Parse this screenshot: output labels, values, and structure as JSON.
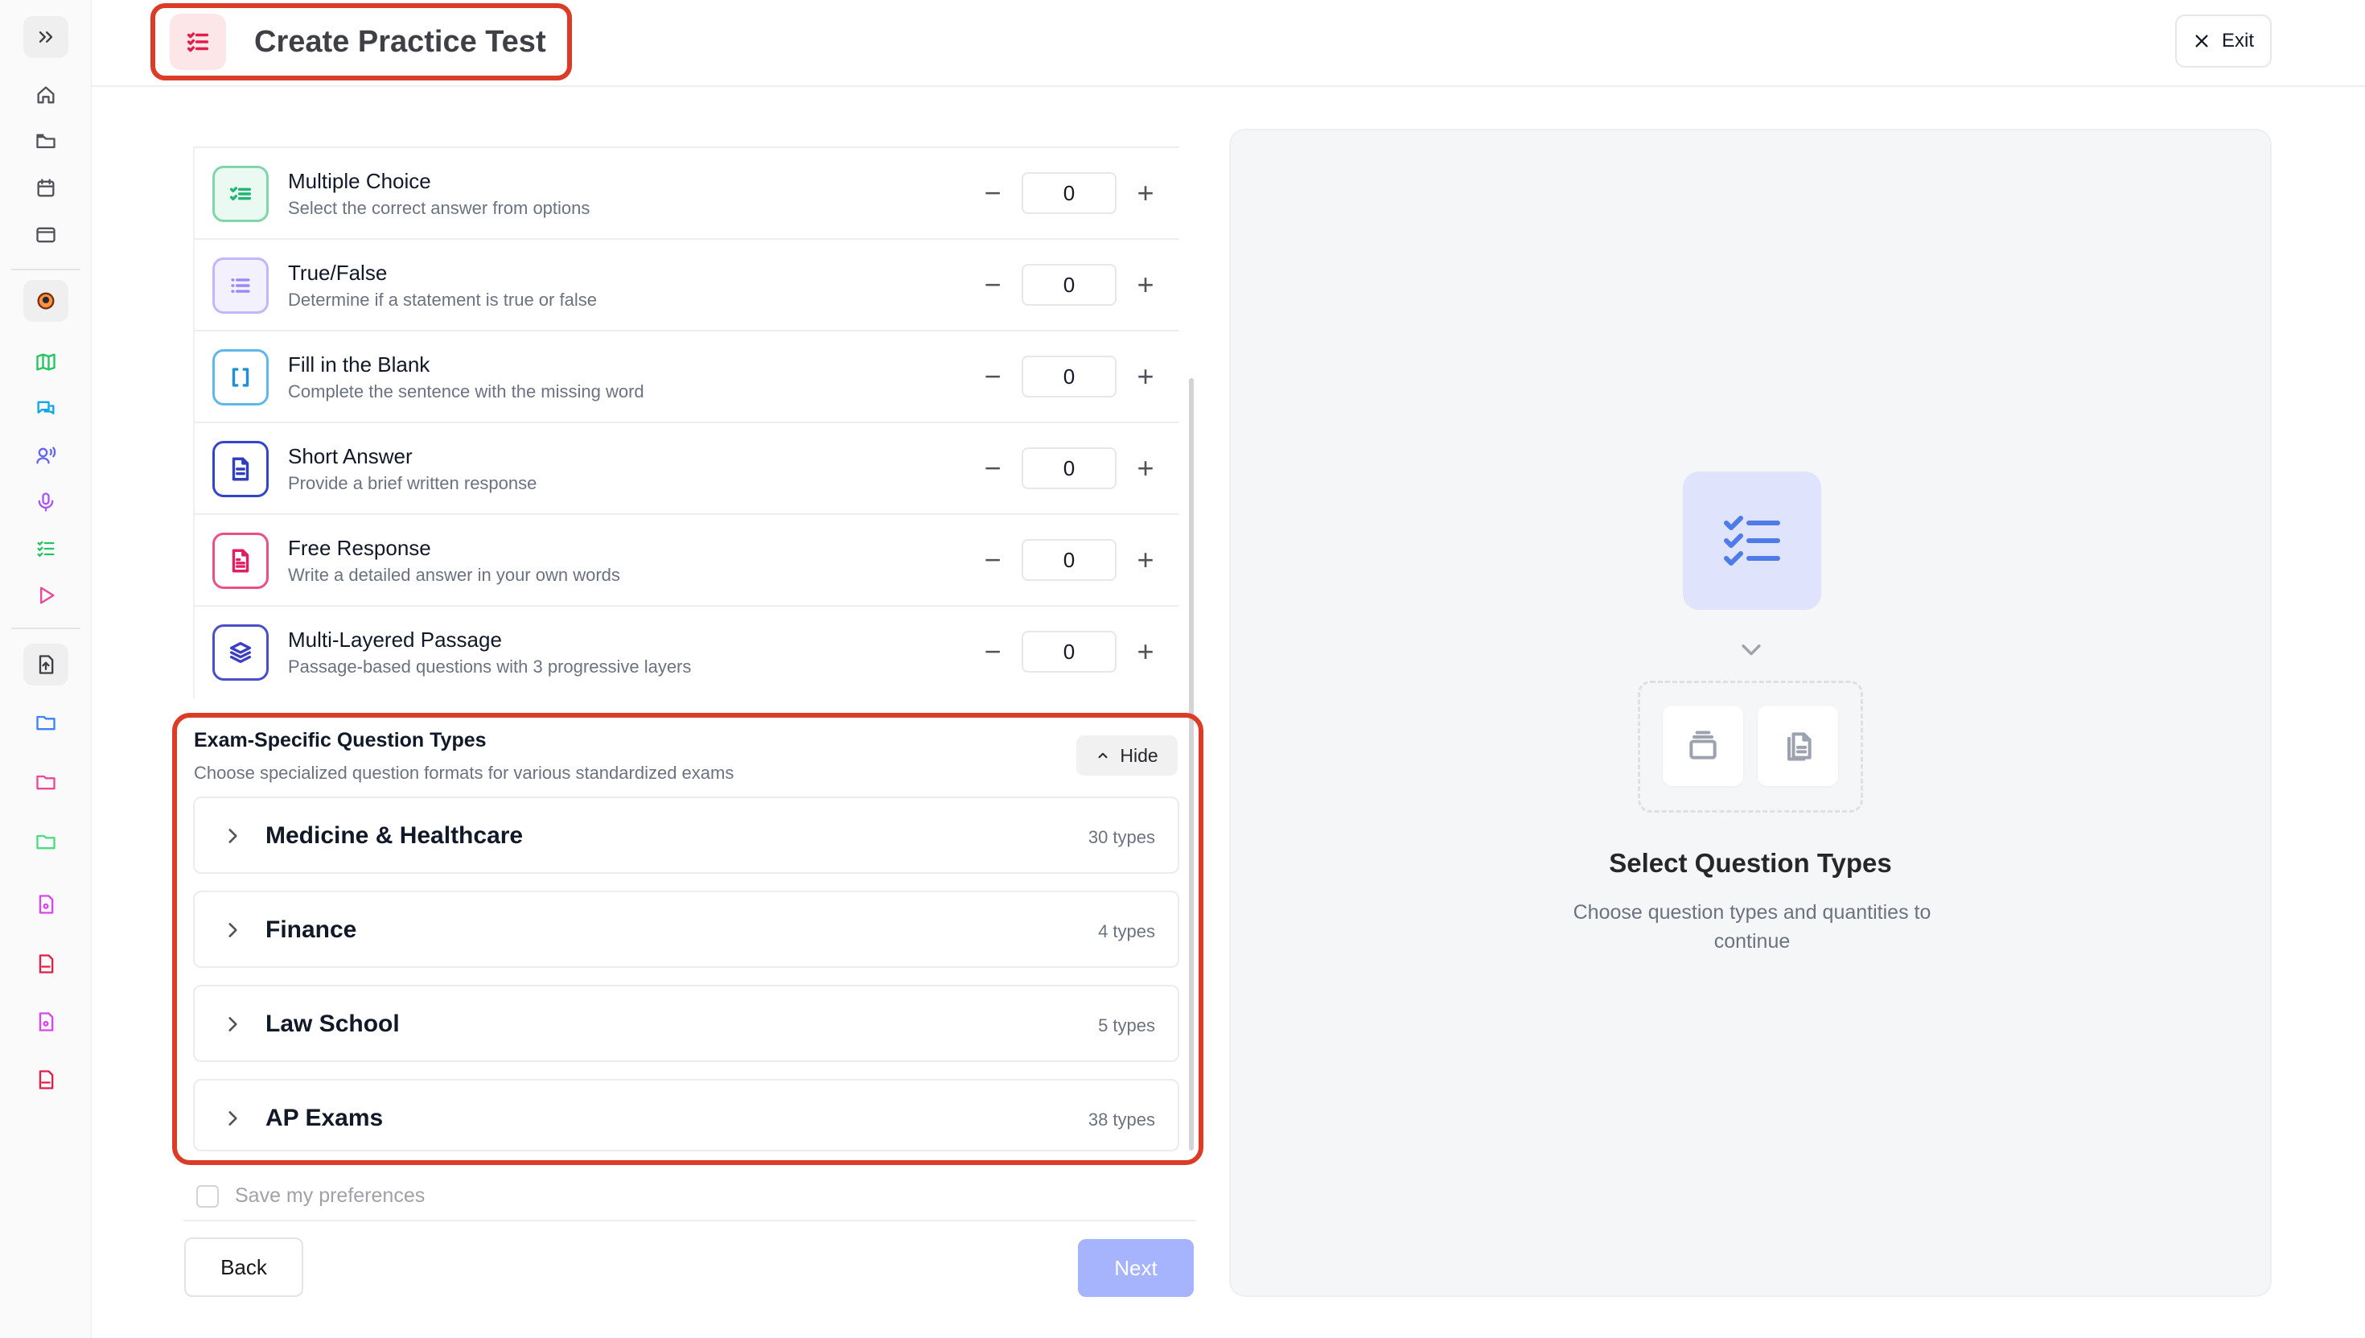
{
  "header": {
    "title": "Create Practice Test",
    "exit_label": "Exit"
  },
  "question_types": [
    {
      "name": "Multiple Choice",
      "description": "Select the correct answer from options",
      "count": "0",
      "icon": "checklist-icon",
      "color": "#22b573",
      "bg": "#eafaf2"
    },
    {
      "name": "True/False",
      "description": "Determine if a statement is true or false",
      "count": "0",
      "icon": "list-icon",
      "color": "#9b87f5",
      "bg": "#f4f1fe"
    },
    {
      "name": "Fill in the Blank",
      "description": "Complete the sentence with the missing word",
      "count": "0",
      "icon": "brackets-icon",
      "color": "#1f8fd6",
      "bg": "#ffffff"
    },
    {
      "name": "Short Answer",
      "description": "Provide a brief written response",
      "count": "0",
      "icon": "document-icon",
      "color": "#2f3fbf",
      "bg": "#ffffff"
    },
    {
      "name": "Free Response",
      "description": "Write a detailed answer in your own words",
      "count": "0",
      "icon": "file-text-icon",
      "color": "#e11d63",
      "bg": "#ffffff"
    },
    {
      "name": "Multi-Layered Passage",
      "description": "Passage-based questions with 3 progressive layers",
      "count": "0",
      "icon": "layers-icon",
      "color": "#3b3fbf",
      "bg": "#ffffff"
    }
  ],
  "exam_section": {
    "title": "Exam-Specific Question Types",
    "subtitle": "Choose specialized question formats for various standardized exams",
    "hide_label": "Hide",
    "categories": [
      {
        "name": "Medicine & Healthcare",
        "count": "30 types"
      },
      {
        "name": "Finance",
        "count": "4 types"
      },
      {
        "name": "Law School",
        "count": "5 types"
      },
      {
        "name": "AP Exams",
        "count": "38 types"
      }
    ]
  },
  "footer": {
    "save_preferences": "Save my preferences",
    "back_label": "Back",
    "next_label": "Next"
  },
  "right_panel": {
    "title": "Select Question Types",
    "subtitle": "Choose question types and quantities to continue"
  },
  "colors": {
    "accent_red": "#dc3b26",
    "next_disabled": "#a5b4fc",
    "illustration_blue": "#4f7be8"
  }
}
